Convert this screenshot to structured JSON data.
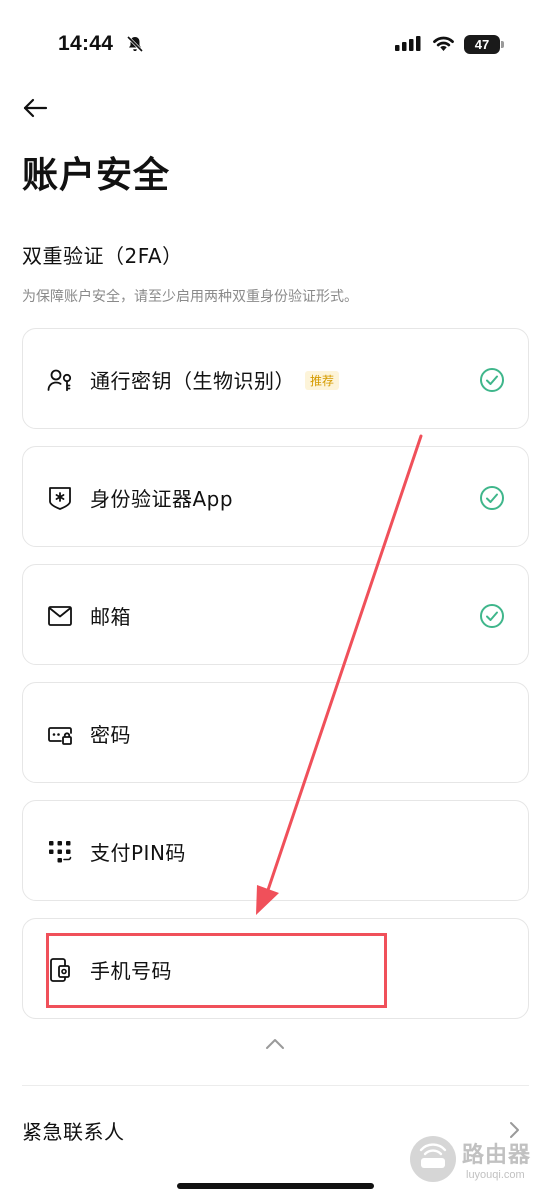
{
  "status_bar": {
    "time": "14:44",
    "battery": "47",
    "icons": [
      "bell-muted-icon",
      "signal-icon",
      "wifi-icon",
      "battery-icon"
    ]
  },
  "header": {
    "back_icon": "arrow-left-icon",
    "title": "账户安全"
  },
  "two_factor": {
    "title": "双重验证（2FA）",
    "description": "为保障账户安全，请至少启用两种双重身份验证形式。",
    "items": [
      {
        "label": "通行密钥（生物识别）",
        "tag": "推荐",
        "icon": "passkey-icon",
        "enabled": true
      },
      {
        "label": "身份验证器App",
        "icon": "authenticator-icon",
        "enabled": true
      },
      {
        "label": "邮箱",
        "icon": "mail-icon",
        "enabled": true
      },
      {
        "label": "密码",
        "icon": "password-icon",
        "enabled": false
      },
      {
        "label": "支付PIN码",
        "icon": "pin-keypad-icon",
        "enabled": false
      },
      {
        "label": "手机号码",
        "icon": "phone-icon",
        "enabled": false
      }
    ],
    "collapse_icon": "chevron-up-icon"
  },
  "emergency_contact": {
    "label": "紧急联系人",
    "icon": "chevron-right-icon"
  },
  "watermark": {
    "title": "路由器",
    "subtitle": "luyouqi.com"
  },
  "colors": {
    "check": "#3fb68b",
    "tag_bg": "#fdf4d9",
    "tag_text": "#d59b00",
    "annotation": "#f0505a"
  }
}
